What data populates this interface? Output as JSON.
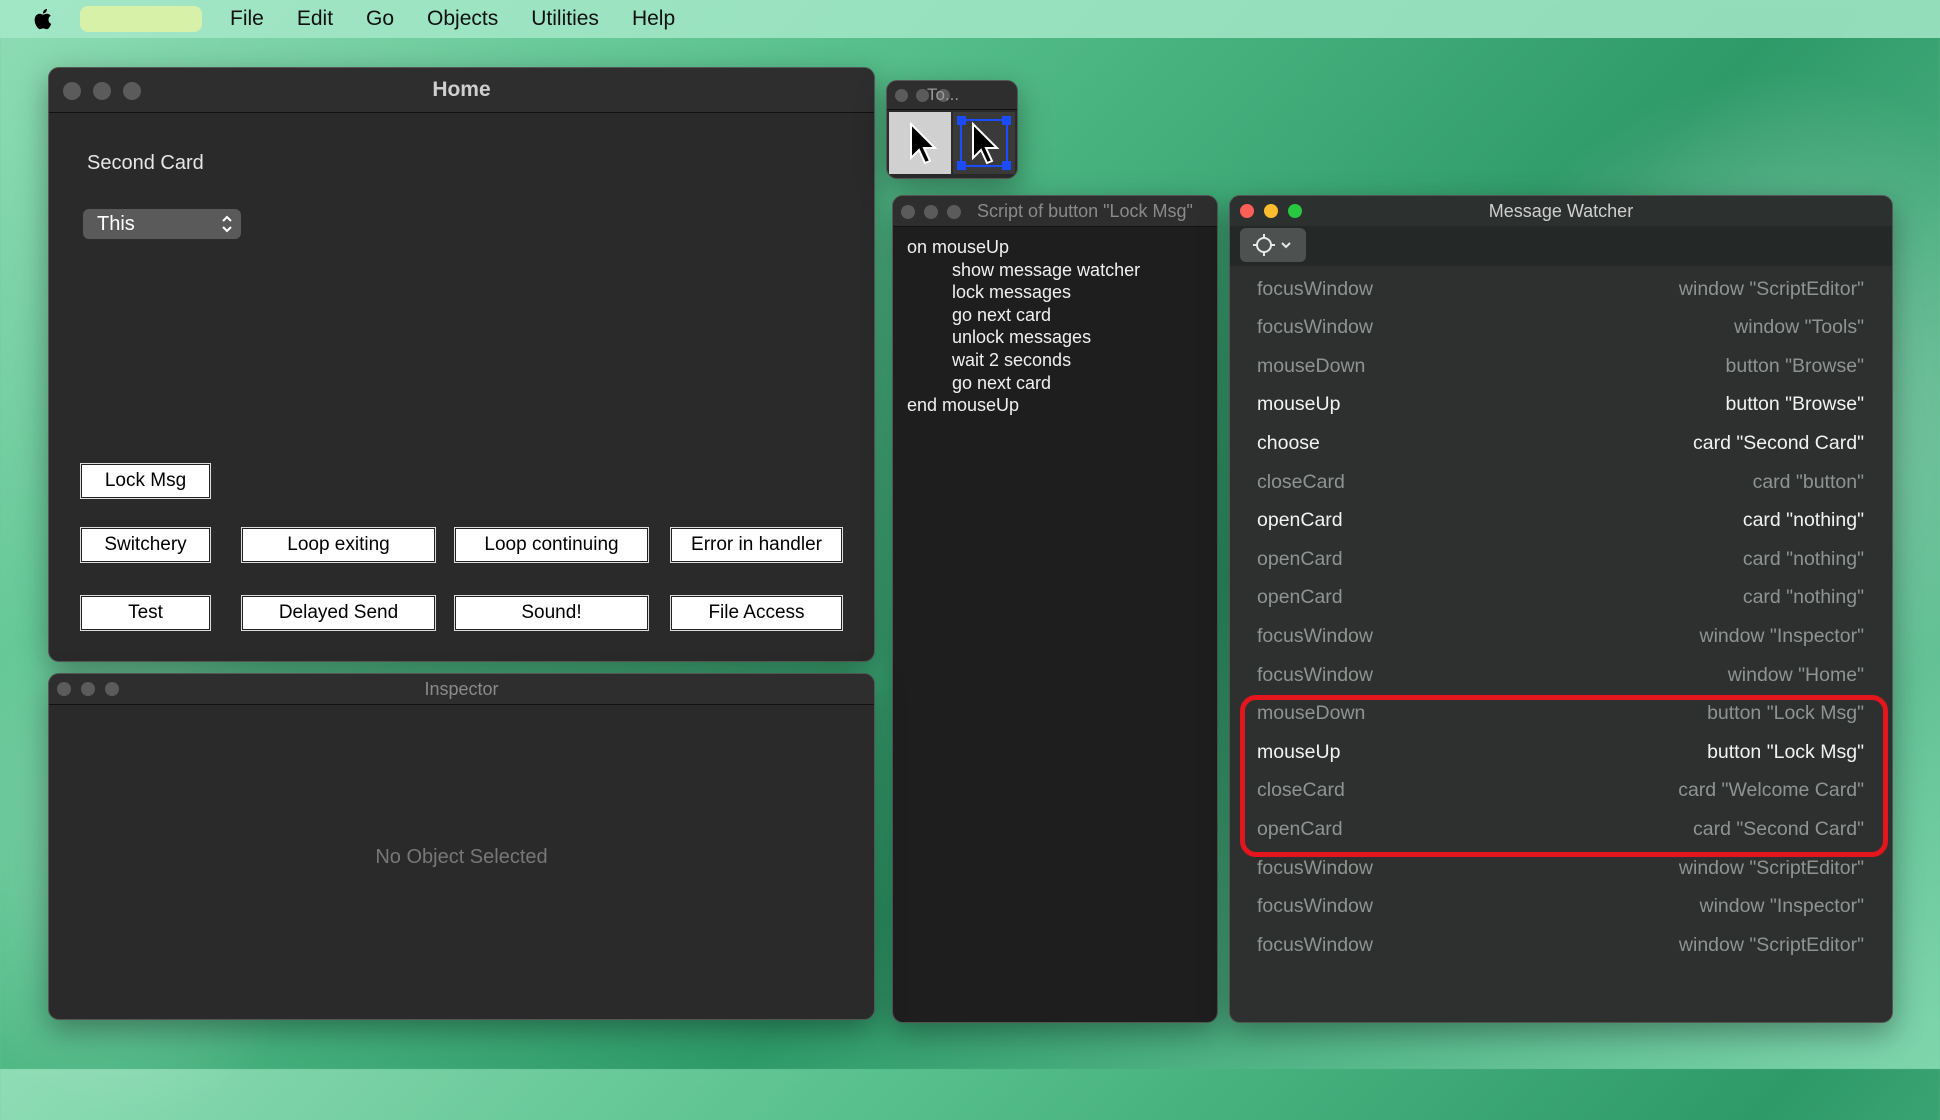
{
  "menubar": {
    "items": [
      "File",
      "Edit",
      "Go",
      "Objects",
      "Utilities",
      "Help"
    ]
  },
  "home": {
    "title": "Home",
    "card_name": "Second Card",
    "popup_value": "This",
    "buttons": {
      "lock_msg": "Lock Msg",
      "switchery": "Switchery",
      "loop_exiting": "Loop exiting",
      "loop_continuing": "Loop continuing",
      "error_in_handler": "Error in handler",
      "test": "Test",
      "delayed_send": "Delayed Send",
      "sound": "Sound!",
      "file_access": "File Access"
    }
  },
  "tools": {
    "title": "To...",
    "tools": [
      "arrow-browse-icon",
      "arrow-edit-icon"
    ]
  },
  "script": {
    "title": "Script of button \"Lock Msg\"",
    "lines": [
      "on mouseUp",
      "show message watcher",
      "lock messages",
      "go next card",
      "unlock messages",
      "wait 2 seconds",
      "go next card",
      "end mouseUp"
    ]
  },
  "message_watcher": {
    "title": "Message Watcher",
    "rows": [
      {
        "msg": "focusWindow",
        "target": "window \"ScriptEditor\"",
        "bright": false
      },
      {
        "msg": "focusWindow",
        "target": "window \"Tools\"",
        "bright": false
      },
      {
        "msg": "mouseDown",
        "target": "button \"Browse\"",
        "bright": false
      },
      {
        "msg": "mouseUp",
        "target": "button \"Browse\"",
        "bright": true
      },
      {
        "msg": "choose",
        "target": "card \"Second Card\"",
        "bright": true
      },
      {
        "msg": "closeCard",
        "target": "card \"button\"",
        "bright": false
      },
      {
        "msg": "openCard",
        "target": "card \"nothing\"",
        "bright": true
      },
      {
        "msg": "openCard",
        "target": "card \"nothing\"",
        "bright": false
      },
      {
        "msg": "openCard",
        "target": "card \"nothing\"",
        "bright": false
      },
      {
        "msg": "focusWindow",
        "target": "window \"Inspector\"",
        "bright": false
      },
      {
        "msg": "focusWindow",
        "target": "window \"Home\"",
        "bright": false
      },
      {
        "msg": "mouseDown",
        "target": "button \"Lock Msg\"",
        "bright": false
      },
      {
        "msg": "mouseUp",
        "target": "button \"Lock Msg\"",
        "bright": true
      },
      {
        "msg": "closeCard",
        "target": "card \"Welcome Card\"",
        "bright": false
      },
      {
        "msg": "openCard",
        "target": "card \"Second Card\"",
        "bright": false
      },
      {
        "msg": "focusWindow",
        "target": "window \"ScriptEditor\"",
        "bright": false
      },
      {
        "msg": "focusWindow",
        "target": "window \"Inspector\"",
        "bright": false
      },
      {
        "msg": "focusWindow",
        "target": "window \"ScriptEditor\"",
        "bright": false
      }
    ]
  },
  "inspector": {
    "title": "Inspector",
    "empty_text": "No Object Selected"
  },
  "colors": {
    "highlight": "#e3161d",
    "dim_text": "#8f9491",
    "bright_text": "#f2f2f2"
  }
}
